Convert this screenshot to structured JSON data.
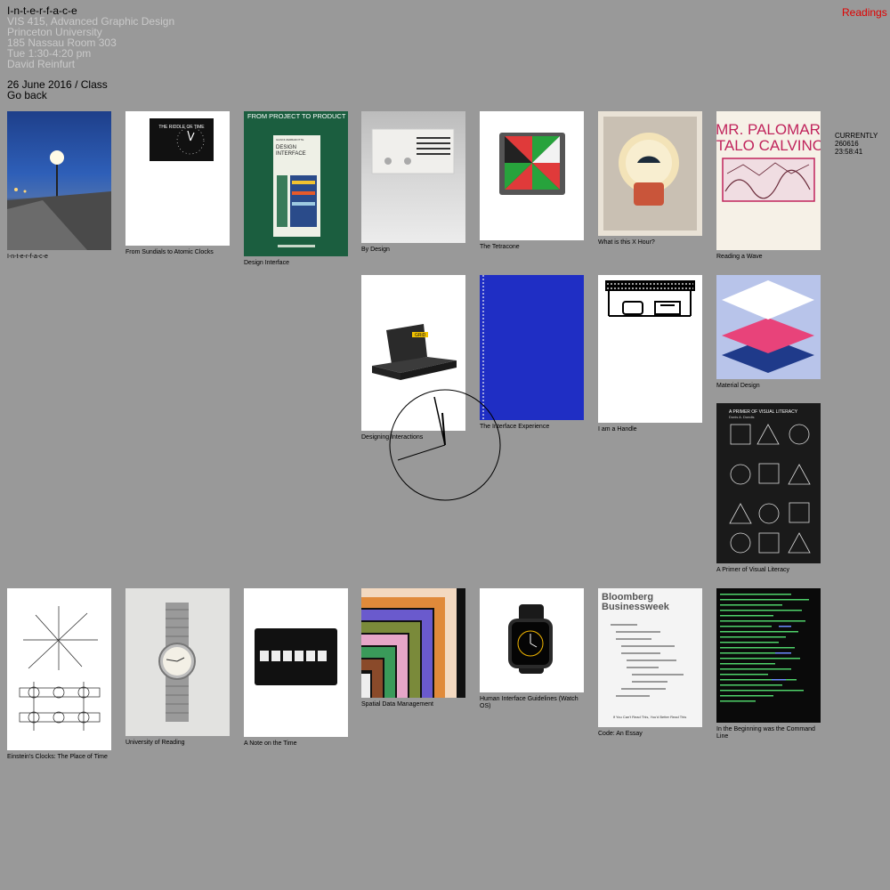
{
  "header": {
    "title": "I-n-t-e-r-f-a-c-e",
    "course": "VIS 415, Advanced Graphic Design",
    "school": "Princeton University",
    "room": "185 Nassau Room 303",
    "time": "Tue 1:30-4:20 pm",
    "instructor": "David Reinfurt"
  },
  "subhead": {
    "date": "26 June 2016 / Class",
    "back": "Go back"
  },
  "nav": {
    "readings": "Readings"
  },
  "currently": {
    "label": "CURRENTLY",
    "date": "260616",
    "time": "23:58:41"
  },
  "cards": {
    "interface": "I-n-t-e-r-f-a-c-e",
    "sundials": "From Sundials to Atomic Clocks",
    "design_interface": "Design Interface",
    "by_design": "By Design",
    "tetracone": "The Tetracone",
    "x_hour": "What is this X Hour?",
    "wave": "Reading a Wave",
    "designing": "Designing Interactions",
    "experience": "The Interface Experience",
    "handle": "I am a Handle",
    "material": "Material Design",
    "primer": "A Primer of Visual Literacy",
    "einstein": "Einstein's Clocks: The Place of Time",
    "reading": "University of Reading",
    "note_time": "A Note on the Time",
    "spatial": "Spatial Data Management",
    "hig": "Human Interface Guidelines (Watch OS)",
    "code": "Code: An Essay",
    "command": "In the Beginning was the Command Line"
  },
  "covers": {
    "sundials_title": "THE RIDDLE OF TIME",
    "design_interface_band": "FROM PROJECT TO PRODUCT",
    "design_interface_author": "GIANNI ZERBAROTTE",
    "design_interface_title_1": "DESIGN",
    "design_interface_title_2": "INTERFACE",
    "palomar_1": "MR. PALOMAR",
    "palomar_2": "ITALO CALVINO",
    "primer_title": "A PRIMER OF VISUAL LITERACY",
    "primer_author": "Donis A. Dondis",
    "bloomberg_1": "Bloomberg",
    "bloomberg_2": "Businessweek",
    "bloomberg_tag": "If You Can't Read This, You'd Better Read This",
    "grid_label": "GRiD"
  },
  "colors": {
    "background": "#999999",
    "meta_text": "#c9c9c9",
    "readings_link": "#e00000"
  }
}
